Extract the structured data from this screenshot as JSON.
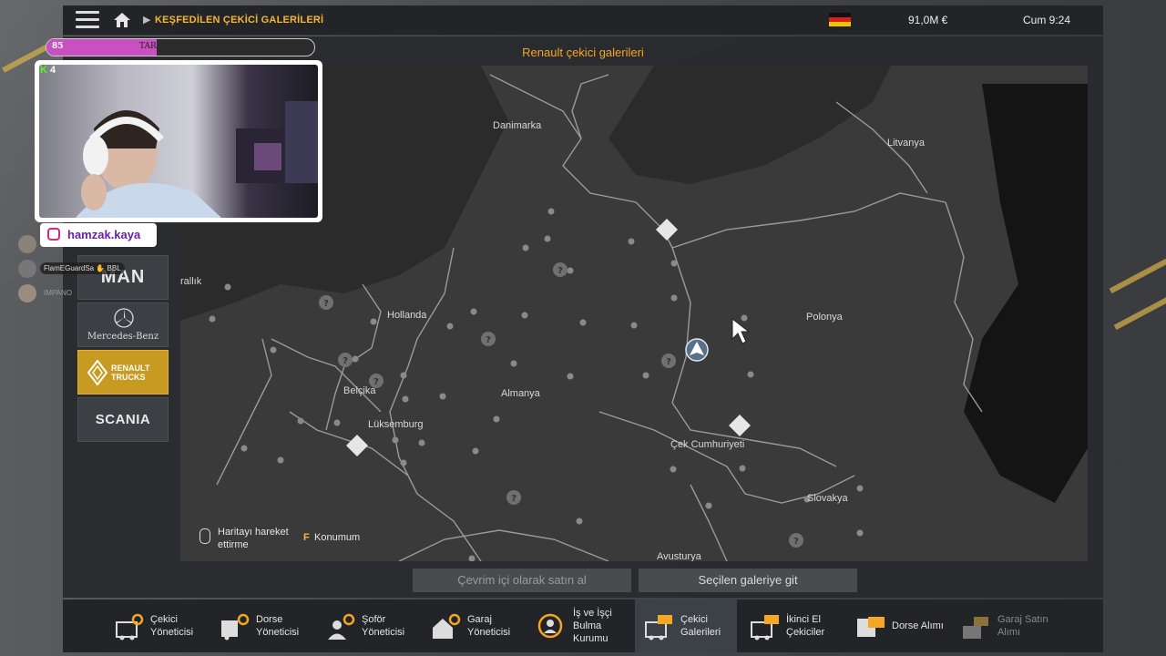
{
  "topbar": {
    "breadcrumb": "KEŞFEDİLEN ÇEKİCİ GALERİLERİ",
    "money": "91,0M  €",
    "clock": "Cum 9:24"
  },
  "panel": {
    "title": "Renault çekici galerileri"
  },
  "map": {
    "labels": {
      "denmark": "Danimarka",
      "lithuania": "Litvanya",
      "netherlands": "Hollanda",
      "poland": "Polonya",
      "france": "rallık",
      "belgium": "Belçika",
      "germany": "Almanya",
      "luxembourg": "Lüksemburg",
      "czech": "Çek Cumhuriyeti",
      "slovakia": "Slovakya",
      "austria": "Avusturya"
    },
    "help_move": "Haritayı hareket ettirme",
    "help_key": "F",
    "help_position": "Konumum"
  },
  "buttons": {
    "buy_online": "Çevrim içi olarak satın al",
    "go_to_dealer": "Seçilen galeriye git"
  },
  "brands": [
    "MAN",
    "Mercedes-Benz",
    "RENAULT TRUCKS",
    "SCANIA"
  ],
  "toolbar": [
    {
      "label": "Çekici\nYöneticisi"
    },
    {
      "label": "Dorse\nYöneticisi"
    },
    {
      "label": "Şoför\nYöneticisi"
    },
    {
      "label": "Garaj\nYöneticisi"
    },
    {
      "label": "İş ve İşçi\nBulma\nKurumu"
    },
    {
      "label": "Çekici\nGalerileri"
    },
    {
      "label": "İkinci El\nÇekiciler"
    },
    {
      "label": "Dorse Alımı"
    },
    {
      "label": "Garaj Satın\nAlımı"
    }
  ],
  "overlay": {
    "level": "85",
    "xp_name": "TAR",
    "xp_progress": 0.41,
    "kick_count": "4",
    "instagram": "hamzak.kaya",
    "viewers": [
      "FlamEGuardSa  ✋ BBL",
      "IMPANO"
    ]
  },
  "colors": {
    "accent": "#f5a623",
    "renault_active": "#c89a21",
    "panel": "#28292c"
  }
}
